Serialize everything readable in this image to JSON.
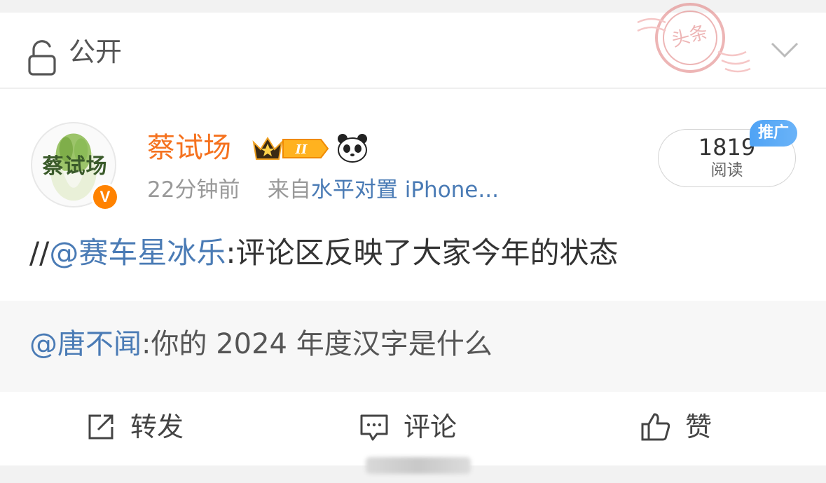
{
  "privacy": {
    "label": "公开",
    "icon": "lock-open-icon",
    "dropdown_icon": "chevron-down-icon"
  },
  "stamp": {
    "text": "头条",
    "icon": "headline-stamp-icon"
  },
  "post": {
    "author": {
      "name": "蔡试场",
      "avatar_text": "蔡试场",
      "verified_badge": "V",
      "badges": [
        "crown-badge-icon",
        "panda-icon"
      ],
      "level_label": "II"
    },
    "time": "22分钟前",
    "source_prefix": "来自",
    "source": "水平对置 iPhone...",
    "reads": {
      "count": "1819",
      "label": "阅读",
      "promo_badge": "推广"
    },
    "text_prefix": "//",
    "mention": "@赛车星冰乐",
    "text_body": ":评论区反映了大家今年的状态",
    "quote": {
      "mention": "@唐不闻",
      "text": ":你的 2024 年度汉字是什么"
    }
  },
  "actions": {
    "repost": {
      "label": "转发",
      "icon": "share-icon"
    },
    "comment": {
      "label": "评论",
      "icon": "comment-icon"
    },
    "like": {
      "label": "赞",
      "icon": "thumbs-up-icon"
    }
  },
  "colors": {
    "username": "#f5721f",
    "link": "#4a7bb5",
    "verify": "#ff8200",
    "promo": "#4fa3f5"
  }
}
